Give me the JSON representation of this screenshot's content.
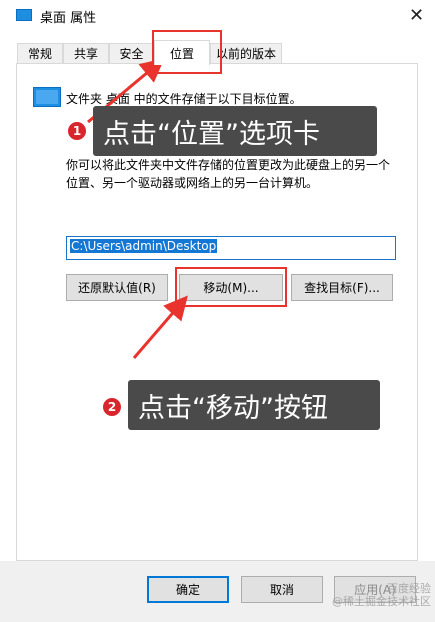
{
  "window": {
    "title": "桌面 属性",
    "close_glyph": "✕"
  },
  "tabs": [
    {
      "label": "常规"
    },
    {
      "label": "共享"
    },
    {
      "label": "安全"
    },
    {
      "label": "位置"
    },
    {
      "label": "以前的版本"
    }
  ],
  "location_panel": {
    "description": "文件夹 桌面 中的文件存储于以下目标位置。",
    "explanation_line1": "你可以将此文件夹中文件存储的位置更改为此硬盘上的另一个",
    "explanation_line2": "位置、另一个驱动器或网络上的另一台计算机。",
    "path_value": "C:\\Users\\admin\\Desktop",
    "restore_default_button": "还原默认值(R)",
    "move_button": "移动(M)...",
    "find_target_button": "查找目标(F)..."
  },
  "dialog_buttons": {
    "ok": "确定",
    "cancel": "取消",
    "apply": "应用(A)"
  },
  "annotations": [
    {
      "number": "1",
      "text": "点击“位置”选项卡"
    },
    {
      "number": "2",
      "text": "点击“移动”按钮"
    }
  ],
  "watermark": {
    "line1": "百度经验",
    "line2": "@稀土掘金技术社区"
  },
  "colors": {
    "annotation_red": "#e8342c",
    "selection_blue": "#1577d4",
    "callout_bg": "#4a4a4a"
  }
}
